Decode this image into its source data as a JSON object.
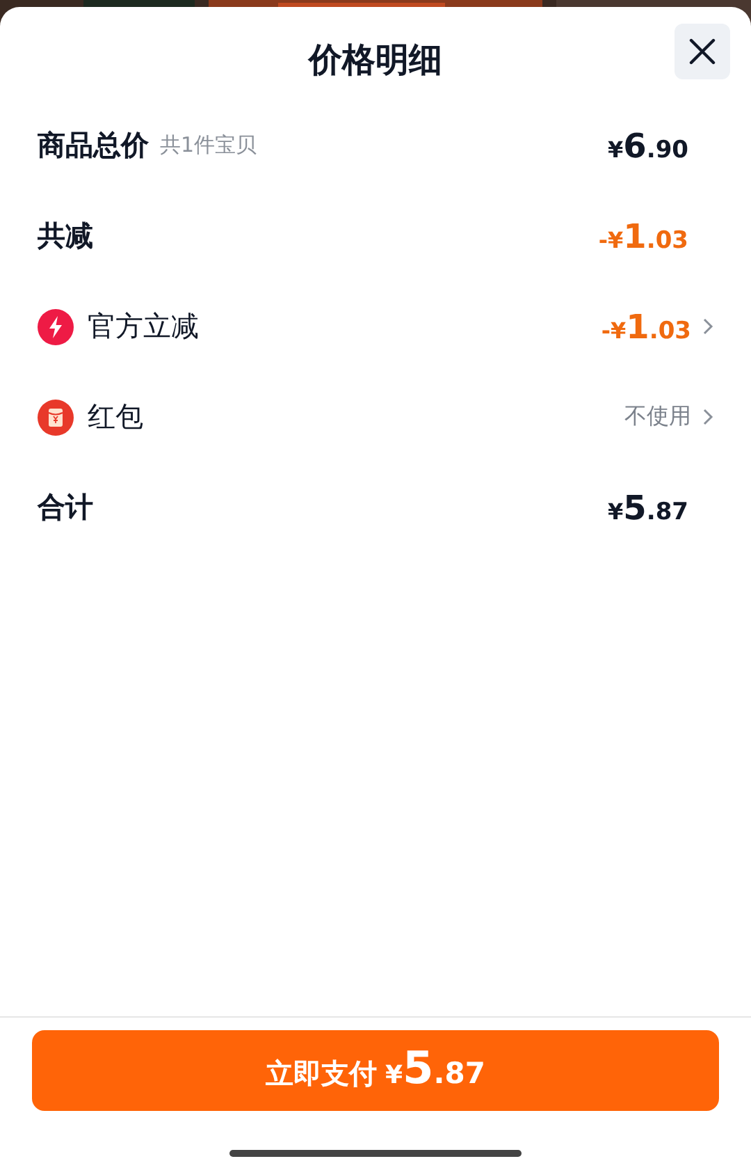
{
  "sheet": {
    "title": "价格明细"
  },
  "rows": [
    {
      "kind": "plain",
      "label": "商品总价",
      "note": "共1件宝贝",
      "value": "¥6.90",
      "color": "#111827",
      "chevron": false
    },
    {
      "kind": "plain",
      "label": "共减",
      "value": "-¥1.03",
      "color": "#f06a0f",
      "chevron": false
    },
    {
      "kind": "lightning",
      "label": "官方立减",
      "value": "-¥1.03",
      "color": "#f06a0f",
      "chevron": true
    },
    {
      "kind": "red-packet",
      "label": "红包",
      "value": "不使用",
      "color": "#7b818b",
      "chevron": true
    },
    {
      "kind": "plain",
      "label": "合计",
      "value": "¥5.87",
      "color": "#111827",
      "chevron": false
    }
  ],
  "pay_button": {
    "label": "立即支付",
    "amount": "¥5.87"
  }
}
